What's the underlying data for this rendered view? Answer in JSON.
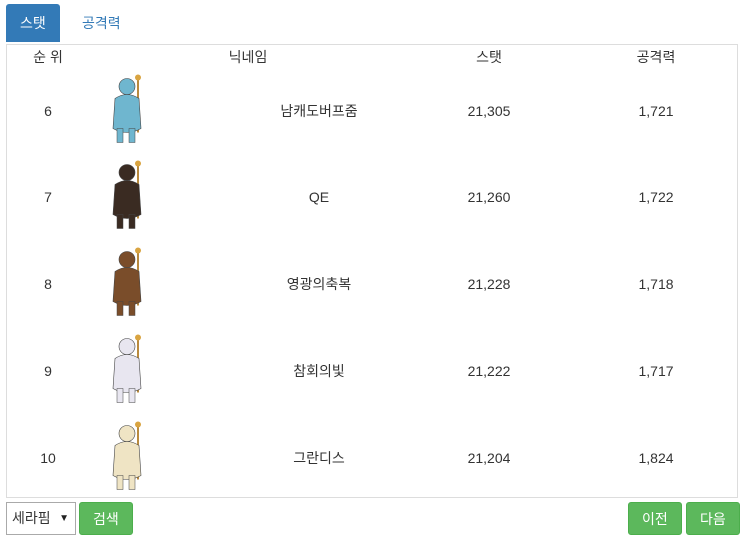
{
  "tabs": [
    {
      "label": "스탯"
    },
    {
      "label": "공격력"
    }
  ],
  "table": {
    "headers": {
      "rank": "순 위",
      "nickname": "닉네임",
      "stat": "스탯",
      "attack": "공격력"
    },
    "rows": [
      {
        "rank": "6",
        "nickname": "남캐도버프줌",
        "stat": "21,305",
        "attack": "1,721",
        "avatar": "blue-robed-character",
        "color": "#6fb6cf"
      },
      {
        "rank": "7",
        "nickname": "QE",
        "stat": "21,260",
        "attack": "1,722",
        "avatar": "dark-armored-character",
        "color": "#3a2b22"
      },
      {
        "rank": "8",
        "nickname": "영광의축복",
        "stat": "21,228",
        "attack": "1,718",
        "avatar": "brown-armored-character",
        "color": "#7a4d2a"
      },
      {
        "rank": "9",
        "nickname": "참회의빛",
        "stat": "21,222",
        "attack": "1,717",
        "avatar": "white-robed-character",
        "color": "#e8e6f0"
      },
      {
        "rank": "10",
        "nickname": "그란디스",
        "stat": "21,204",
        "attack": "1,824",
        "avatar": "cream-robed-character",
        "color": "#efe4c4"
      }
    ]
  },
  "controls": {
    "server_select": "세라핌",
    "search_label": "검색",
    "prev_label": "이전",
    "next_label": "다음"
  },
  "colors": {
    "tab_active": "#337ab7",
    "button": "#5cb85c"
  }
}
